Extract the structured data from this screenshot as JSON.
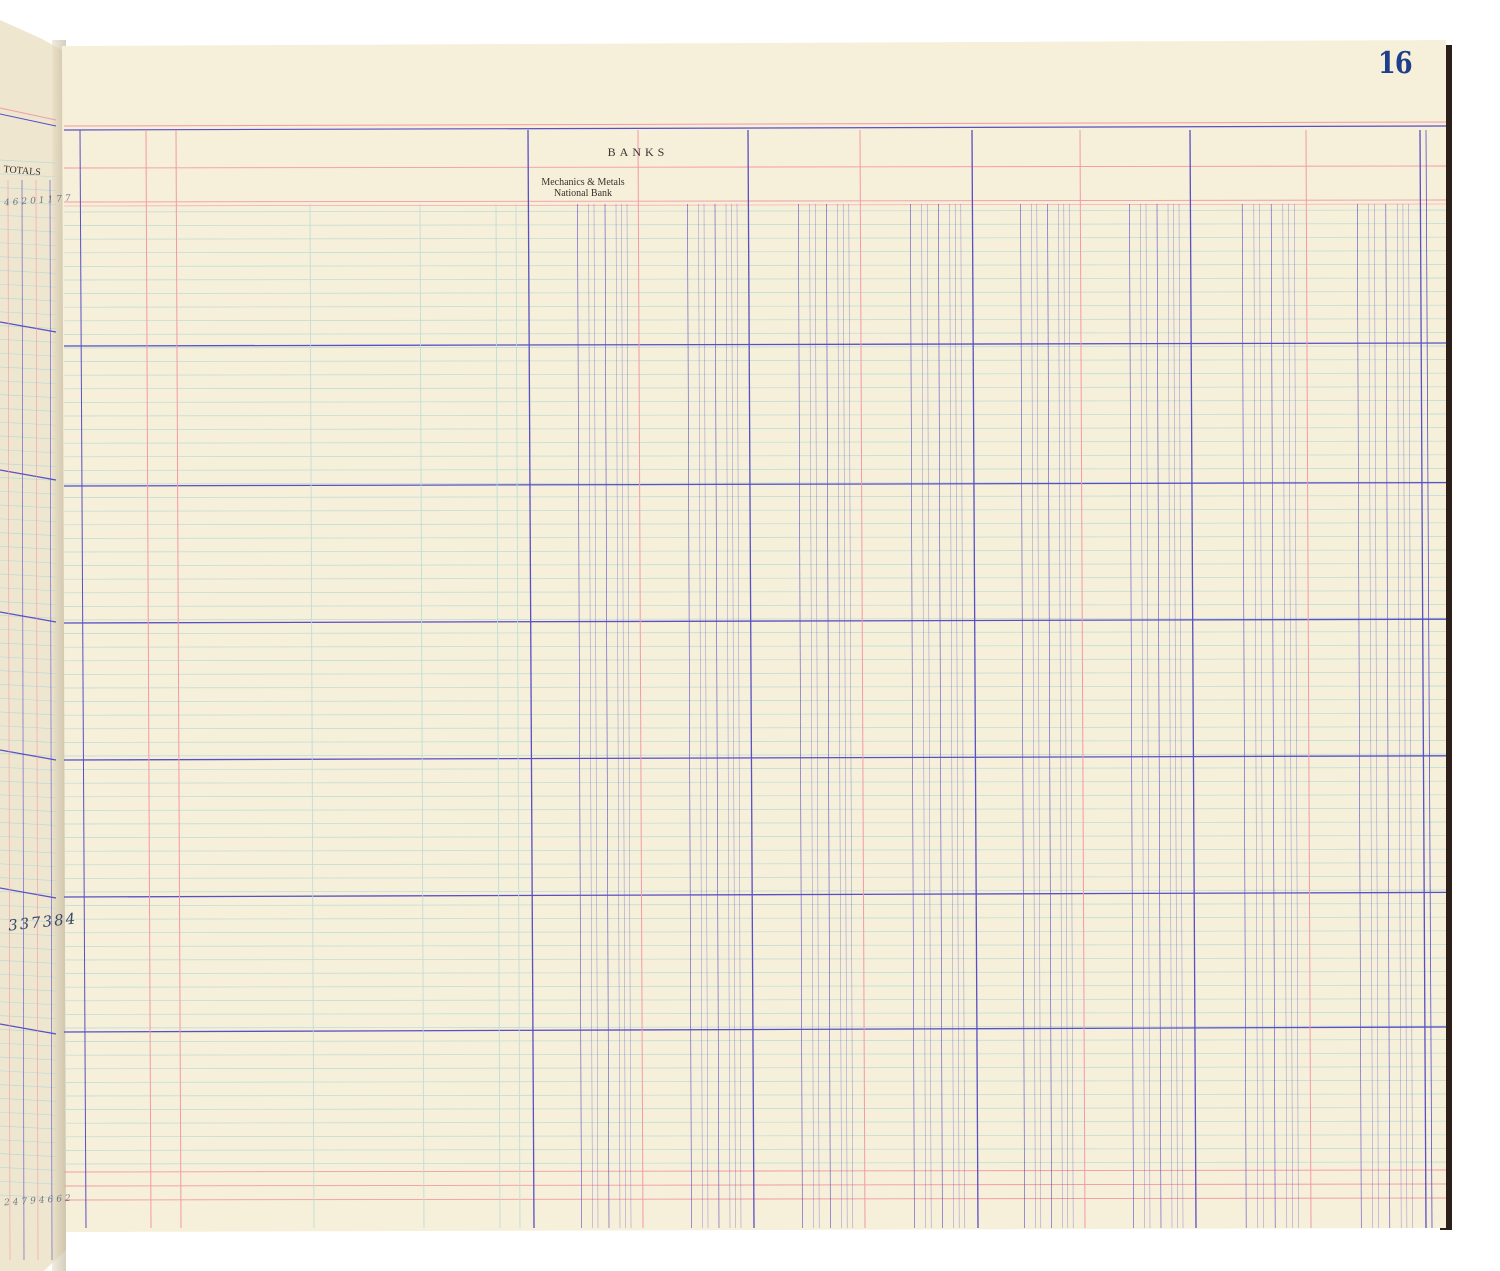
{
  "ledger": {
    "page_number": "16",
    "section_heading": "BANKS",
    "bank_column_label_line1": "Mechanics & Metals",
    "bank_column_label_line2": "National Bank"
  },
  "left_page": {
    "column_label": "TOTALS",
    "handwritten_amount": "337384",
    "handwritten_top": "46201177",
    "handwritten_bottom": "24794662"
  },
  "colors": {
    "paper": "#f6efd9",
    "blue_rule": "#5a4fc4",
    "red_rule": "#f39aa5",
    "teal_rule": "#b9dcd6",
    "page_number": "#1f3f8a"
  }
}
